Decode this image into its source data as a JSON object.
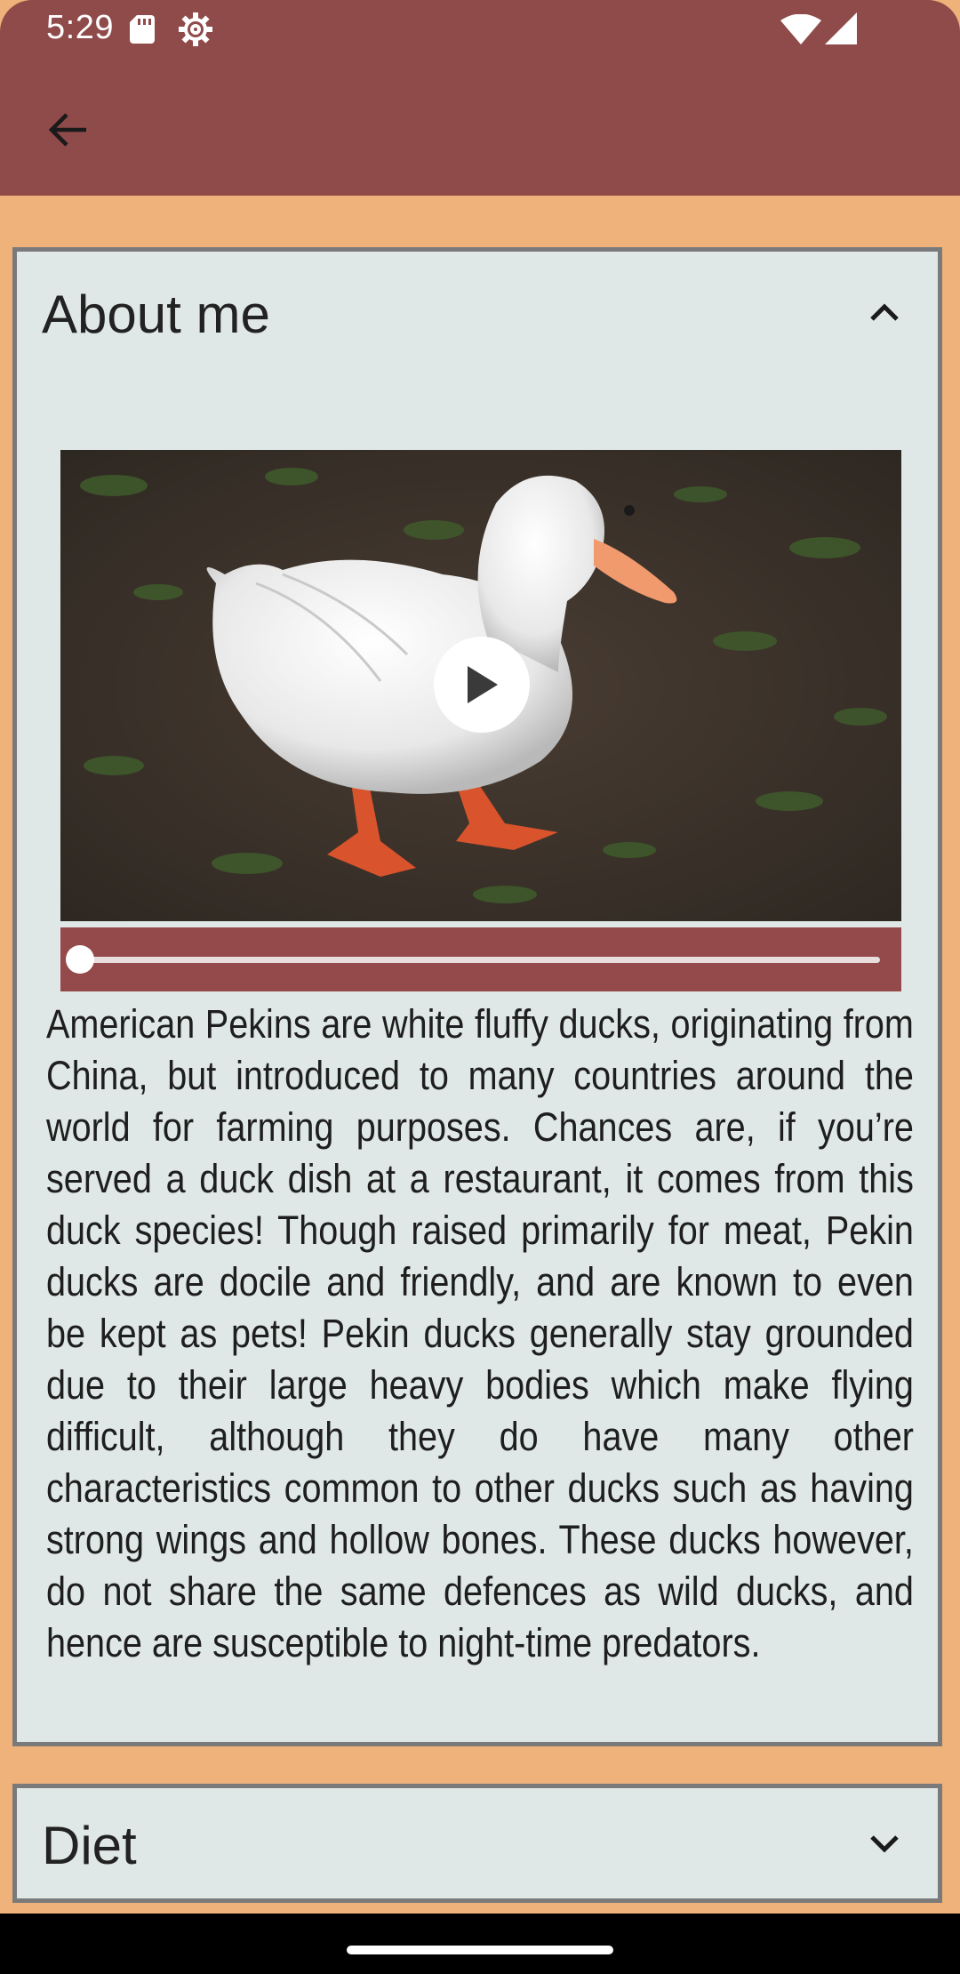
{
  "status_bar": {
    "time": "5:29",
    "icons": [
      "sd-card-icon",
      "settings-gear-icon",
      "wifi-icon",
      "cell-signal-icon"
    ]
  },
  "app_bar": {
    "back_icon": "arrow-back-icon"
  },
  "sections": {
    "about": {
      "title": "About me",
      "expanded": true,
      "toggle_icon": "chevron-up-icon",
      "video": {
        "play_icon": "play-icon",
        "progress": 0.0
      },
      "body": "American Pekins are white fluffy ducks, originating from China, but introduced to many countries around the world for farming purposes. Chances are, if you’re served a duck dish at a restaurant, it comes from this duck species! Though raised primarily for meat, Pekin ducks are docile and friendly, and are known to even be kept as pets! Pekin ducks generally stay grounded due to their large heavy bodies which make flying difficult, although they do have many other characteristics common to other ducks such as having strong wings and hollow bones. These ducks however, do not share the same defences as wild ducks, and hence are susceptible to night-time predators."
    },
    "diet": {
      "title": "Diet",
      "expanded": false,
      "toggle_icon": "chevron-down-icon"
    }
  },
  "colors": {
    "app_bar": "#8f4a4a",
    "background": "#efb27a",
    "card": "#dfe8e6",
    "seekbar": "#944a4a"
  }
}
